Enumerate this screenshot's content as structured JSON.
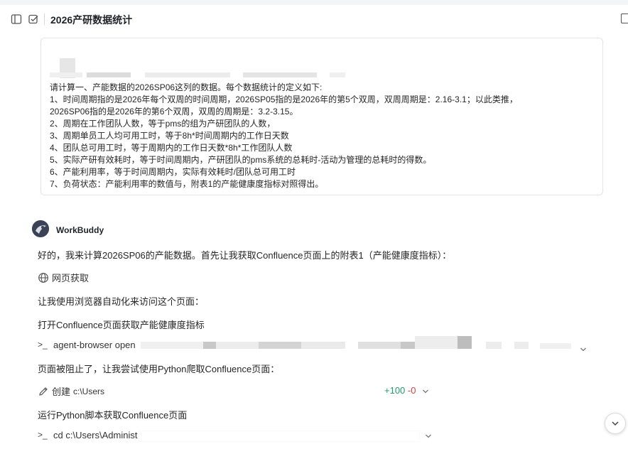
{
  "header": {
    "title": "2026产研数据统计"
  },
  "prompt": {
    "lines": [
      "请计算一、产能数据的2026SP06这列的数据。每个数据统计的定义如下:",
      "1、时间周期指的是2026年每个双周的时间周期，2026SP05指的是2026年的第5个双周，双周周期是：2.16-3.1；以此类推，",
      "2026SP06指的是2026年的第6个双周，双周的周期是：3.2-3.15。",
      "2、周期在工作团队人数，等于pms的组为产研团队的人数，",
      "3、周期单员工人均可用工时，等于8h*时间周期内的工作日天数",
      "4、团队总可用工时，等于周期内的工作日天数*8h*工作团队人数",
      "5、实际产研有效耗时，等于时间周期内，产研团队的pms系统的总耗时-活动为管理的总耗时的得数。",
      "6、产能利用率，等于时间周期内，实际有效耗时/团队总可用工时",
      "7、负荷状态：产能利用率的数值与，附表1的产能健康度指标对照得出。"
    ]
  },
  "assistant": {
    "name": "WorkBuddy",
    "msg1": "好的，我来计算2026SP06的产能数据。首先让我获取Confluence页面上的附表1（产能健康度指标）：",
    "tool1_label": "网页获取",
    "msg2": "让我使用浏览器自动化来访问这个页面：",
    "msg3": "打开Confluence页面获取产能健康度指标",
    "cmd1": "agent-browser open",
    "msg4": "页面被阻止了，让我尝试使用Python爬取Confluence页面：",
    "tool2_label": "创建",
    "tool2_path": "c:\\Users",
    "diff_add": "+100",
    "diff_del": "-0",
    "msg5": "运行Python脚本获取Confluence页面",
    "cmd2": "cd c:\\Users\\Administ"
  },
  "icons": {
    "sidebar": "sidebar-toggle-icon",
    "check": "checkbox-icon",
    "globe": "globe-icon",
    "terminal": "terminal-icon",
    "pencil": "pencil-icon",
    "chevron": "chevron-down-icon"
  },
  "colors": {
    "diff_add": "#1e9e6a",
    "diff_del": "#d93f3f"
  }
}
